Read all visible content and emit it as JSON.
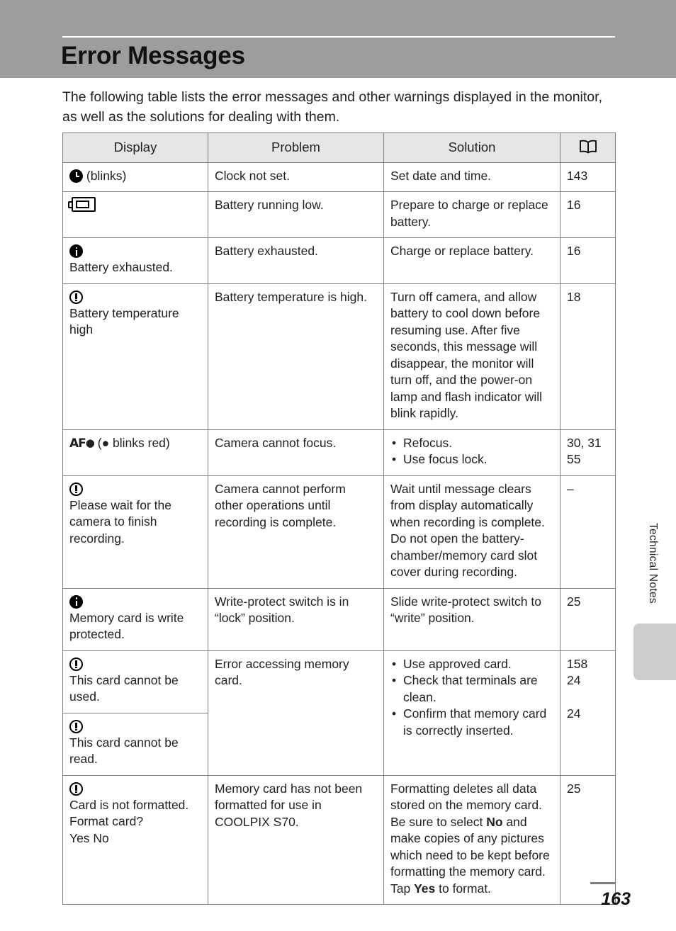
{
  "header": {
    "title": "Error Messages"
  },
  "intro": "The following table lists the error messages and other warnings displayed in the monitor, as well as the solutions for dealing with them.",
  "table": {
    "columns": [
      {
        "label": "Display",
        "icon": ""
      },
      {
        "label": "Problem",
        "icon": ""
      },
      {
        "label": "Solution",
        "icon": ""
      },
      {
        "label": "",
        "icon": "open-book-icon"
      }
    ],
    "rows": [
      {
        "display_icon": "clock-icon",
        "display_text": "(blinks)",
        "display_inline": true,
        "problem": "Clock not set.",
        "solution": "Set date and time.",
        "page": "143"
      },
      {
        "display_icon": "battery-low-icon",
        "display_text": "",
        "display_inline": true,
        "problem": "Battery running low.",
        "solution": "Prepare to charge or replace battery.",
        "page": "16"
      },
      {
        "display_icon": "info-icon",
        "display_text": "Battery exhausted.",
        "display_inline": false,
        "problem": "Battery exhausted.",
        "solution": "Charge or replace battery.",
        "page": "16"
      },
      {
        "display_icon": "warning-icon",
        "display_text": "Battery temperature high",
        "display_inline": false,
        "problem": "Battery temperature is high.",
        "solution": "Turn off camera, and allow battery to cool down before resuming use. After five seconds, this message will disappear, the monitor will turn off, and the power-on lamp and flash indicator will blink rapidly.",
        "page": "18"
      },
      {
        "display_icon": "af-dot-icon",
        "display_text": "(● blinks red)",
        "display_inline": true,
        "problem": "Camera cannot focus.",
        "solution_bullets": [
          "Refocus.",
          "Use focus lock."
        ],
        "page": "30, 31\n55"
      },
      {
        "display_icon": "warning-icon",
        "display_text": "Please wait for the camera to finish recording.",
        "display_inline": false,
        "problem": "Camera cannot perform other operations until recording is complete.",
        "solution": "Wait until message clears from display automatically when recording is complete. Do not open the battery-chamber/memory card slot cover during recording.",
        "page": "–"
      },
      {
        "display_icon": "info-icon",
        "display_text": "Memory card is write protected.",
        "display_inline": false,
        "problem": "Write-protect switch is in “lock” position.",
        "solution": "Slide write-protect switch to “write” position.",
        "page": "25"
      },
      {
        "display_icon": "warning-icon",
        "display_text": "This card cannot be used.",
        "display_inline": false,
        "problem": "Error accessing memory card.",
        "solution_bullets": [
          "Use approved card.",
          "Check that terminals are clean.",
          "Confirm that memory card is correctly inserted."
        ],
        "page": "158\n24\n\n24"
      },
      {
        "display_icon": "warning-icon",
        "display_text": "This card cannot be read.",
        "display_inline": false,
        "problem": "",
        "solution": "",
        "page": ""
      },
      {
        "display_icon": "warning-icon",
        "display_text": "Card is not formatted.\nFormat card?\nYes     No",
        "display_inline": false,
        "problem": "Memory card has not been formatted for use in COOLPIX S70.",
        "solution_rich": [
          {
            "t": "Formatting deletes all data stored on the memory card. Be sure to select "
          },
          {
            "t": "No",
            "b": true
          },
          {
            "t": " and make copies of any pictures which need to be kept before formatting the memory card. Tap "
          },
          {
            "t": "Yes",
            "b": true
          },
          {
            "t": " to format."
          }
        ],
        "page": "25"
      }
    ]
  },
  "side_tab": {
    "label": "Technical Notes"
  },
  "footer": {
    "page_number": "163"
  },
  "colors": {
    "header_band": "#9d9d9d",
    "table_header_bg": "#e6e6e6",
    "border": "#808080",
    "side_tab": "#cccccc"
  }
}
